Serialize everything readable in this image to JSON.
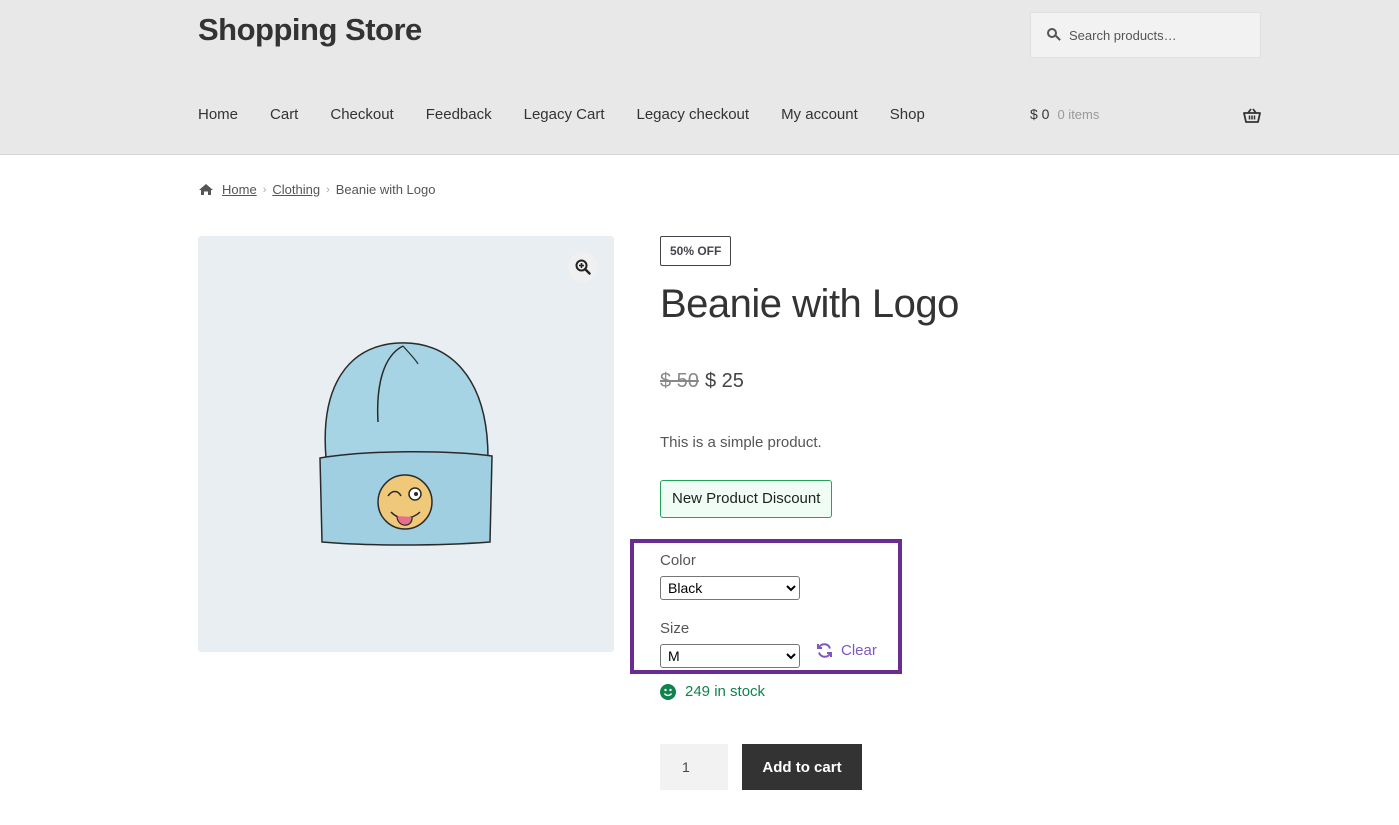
{
  "site": {
    "title": "Shopping Store"
  },
  "search": {
    "placeholder": "Search products…"
  },
  "nav": {
    "items": [
      {
        "label": "Home"
      },
      {
        "label": "Cart"
      },
      {
        "label": "Checkout"
      },
      {
        "label": "Feedback"
      },
      {
        "label": "Legacy Cart"
      },
      {
        "label": "Legacy checkout"
      },
      {
        "label": "My account"
      },
      {
        "label": "Shop"
      }
    ]
  },
  "cart": {
    "amount": "$ 0",
    "count": "0 items",
    "icon": "basket-icon"
  },
  "breadcrumb": {
    "home": "Home",
    "category": "Clothing",
    "current": "Beanie with Logo",
    "icon": "home-icon"
  },
  "product": {
    "badge": "50% OFF",
    "title": "Beanie with Logo",
    "regular_price": "$ 50",
    "sale_price": "$ 25",
    "short_description": "This is a simple product.",
    "discount_label": "New Product Discount",
    "image": {
      "name": "beanie-with-logo",
      "background": "#e8eef1",
      "accent": "#a7d4e4"
    },
    "variations": {
      "color": {
        "label": "Color",
        "value": "Black"
      },
      "size": {
        "label": "Size",
        "value": "M"
      },
      "clear_label": "Clear",
      "highlight_color": "#6a2c91"
    },
    "stock": {
      "text": "249 in stock",
      "color": "#0f834d"
    },
    "quantity": "1",
    "add_to_cart_label": "Add to cart"
  },
  "colors": {
    "link_accent": "#7e57c2",
    "header_bg": "#e8e8e8",
    "button_bg": "#333333"
  }
}
